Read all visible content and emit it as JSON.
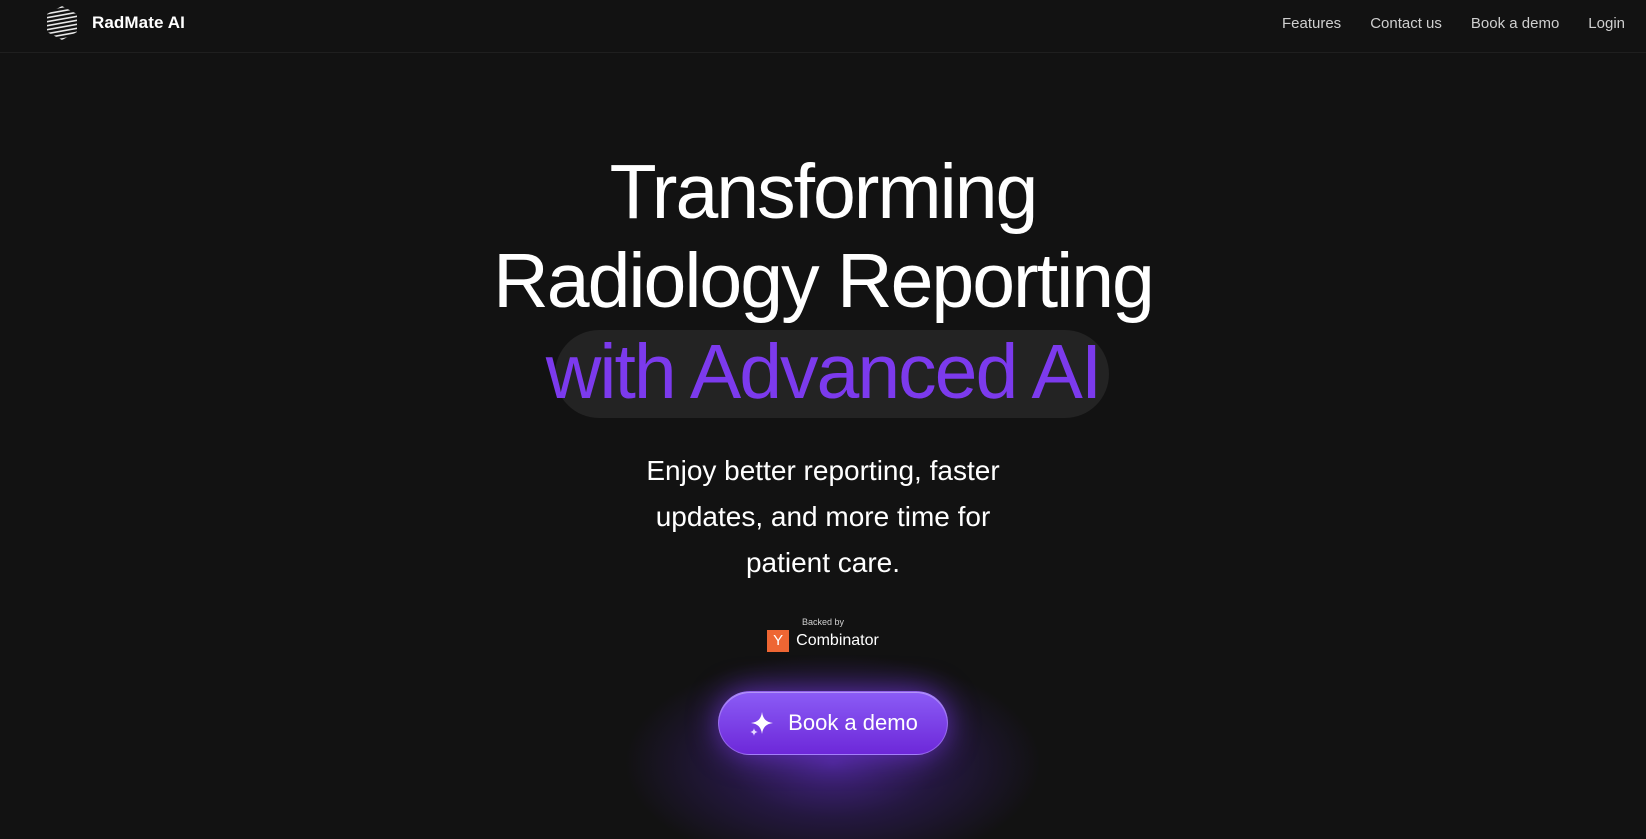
{
  "header": {
    "brand": "RadMate AI",
    "logo_icon": "striped-sphere-logo-icon",
    "nav": [
      {
        "label": "Features"
      },
      {
        "label": "Contact us"
      },
      {
        "label": "Book a demo"
      },
      {
        "label": "Login"
      }
    ]
  },
  "hero": {
    "title_line1": "Transforming",
    "title_line2": "Radiology Reporting",
    "title_line3": "with Advanced AI",
    "subtitle": "Enjoy better reporting, faster updates, and more time for patient care.",
    "backed_label": "Backed by",
    "backer_logo_letter": "Y",
    "backer_name": "Combinator",
    "cta_label": "Book a demo",
    "cta_icon": "sparkle-icon"
  },
  "colors": {
    "background": "#121212",
    "accent": "#7c3aed",
    "highlight_pill": "#232323",
    "yc_orange": "#ee6633"
  }
}
